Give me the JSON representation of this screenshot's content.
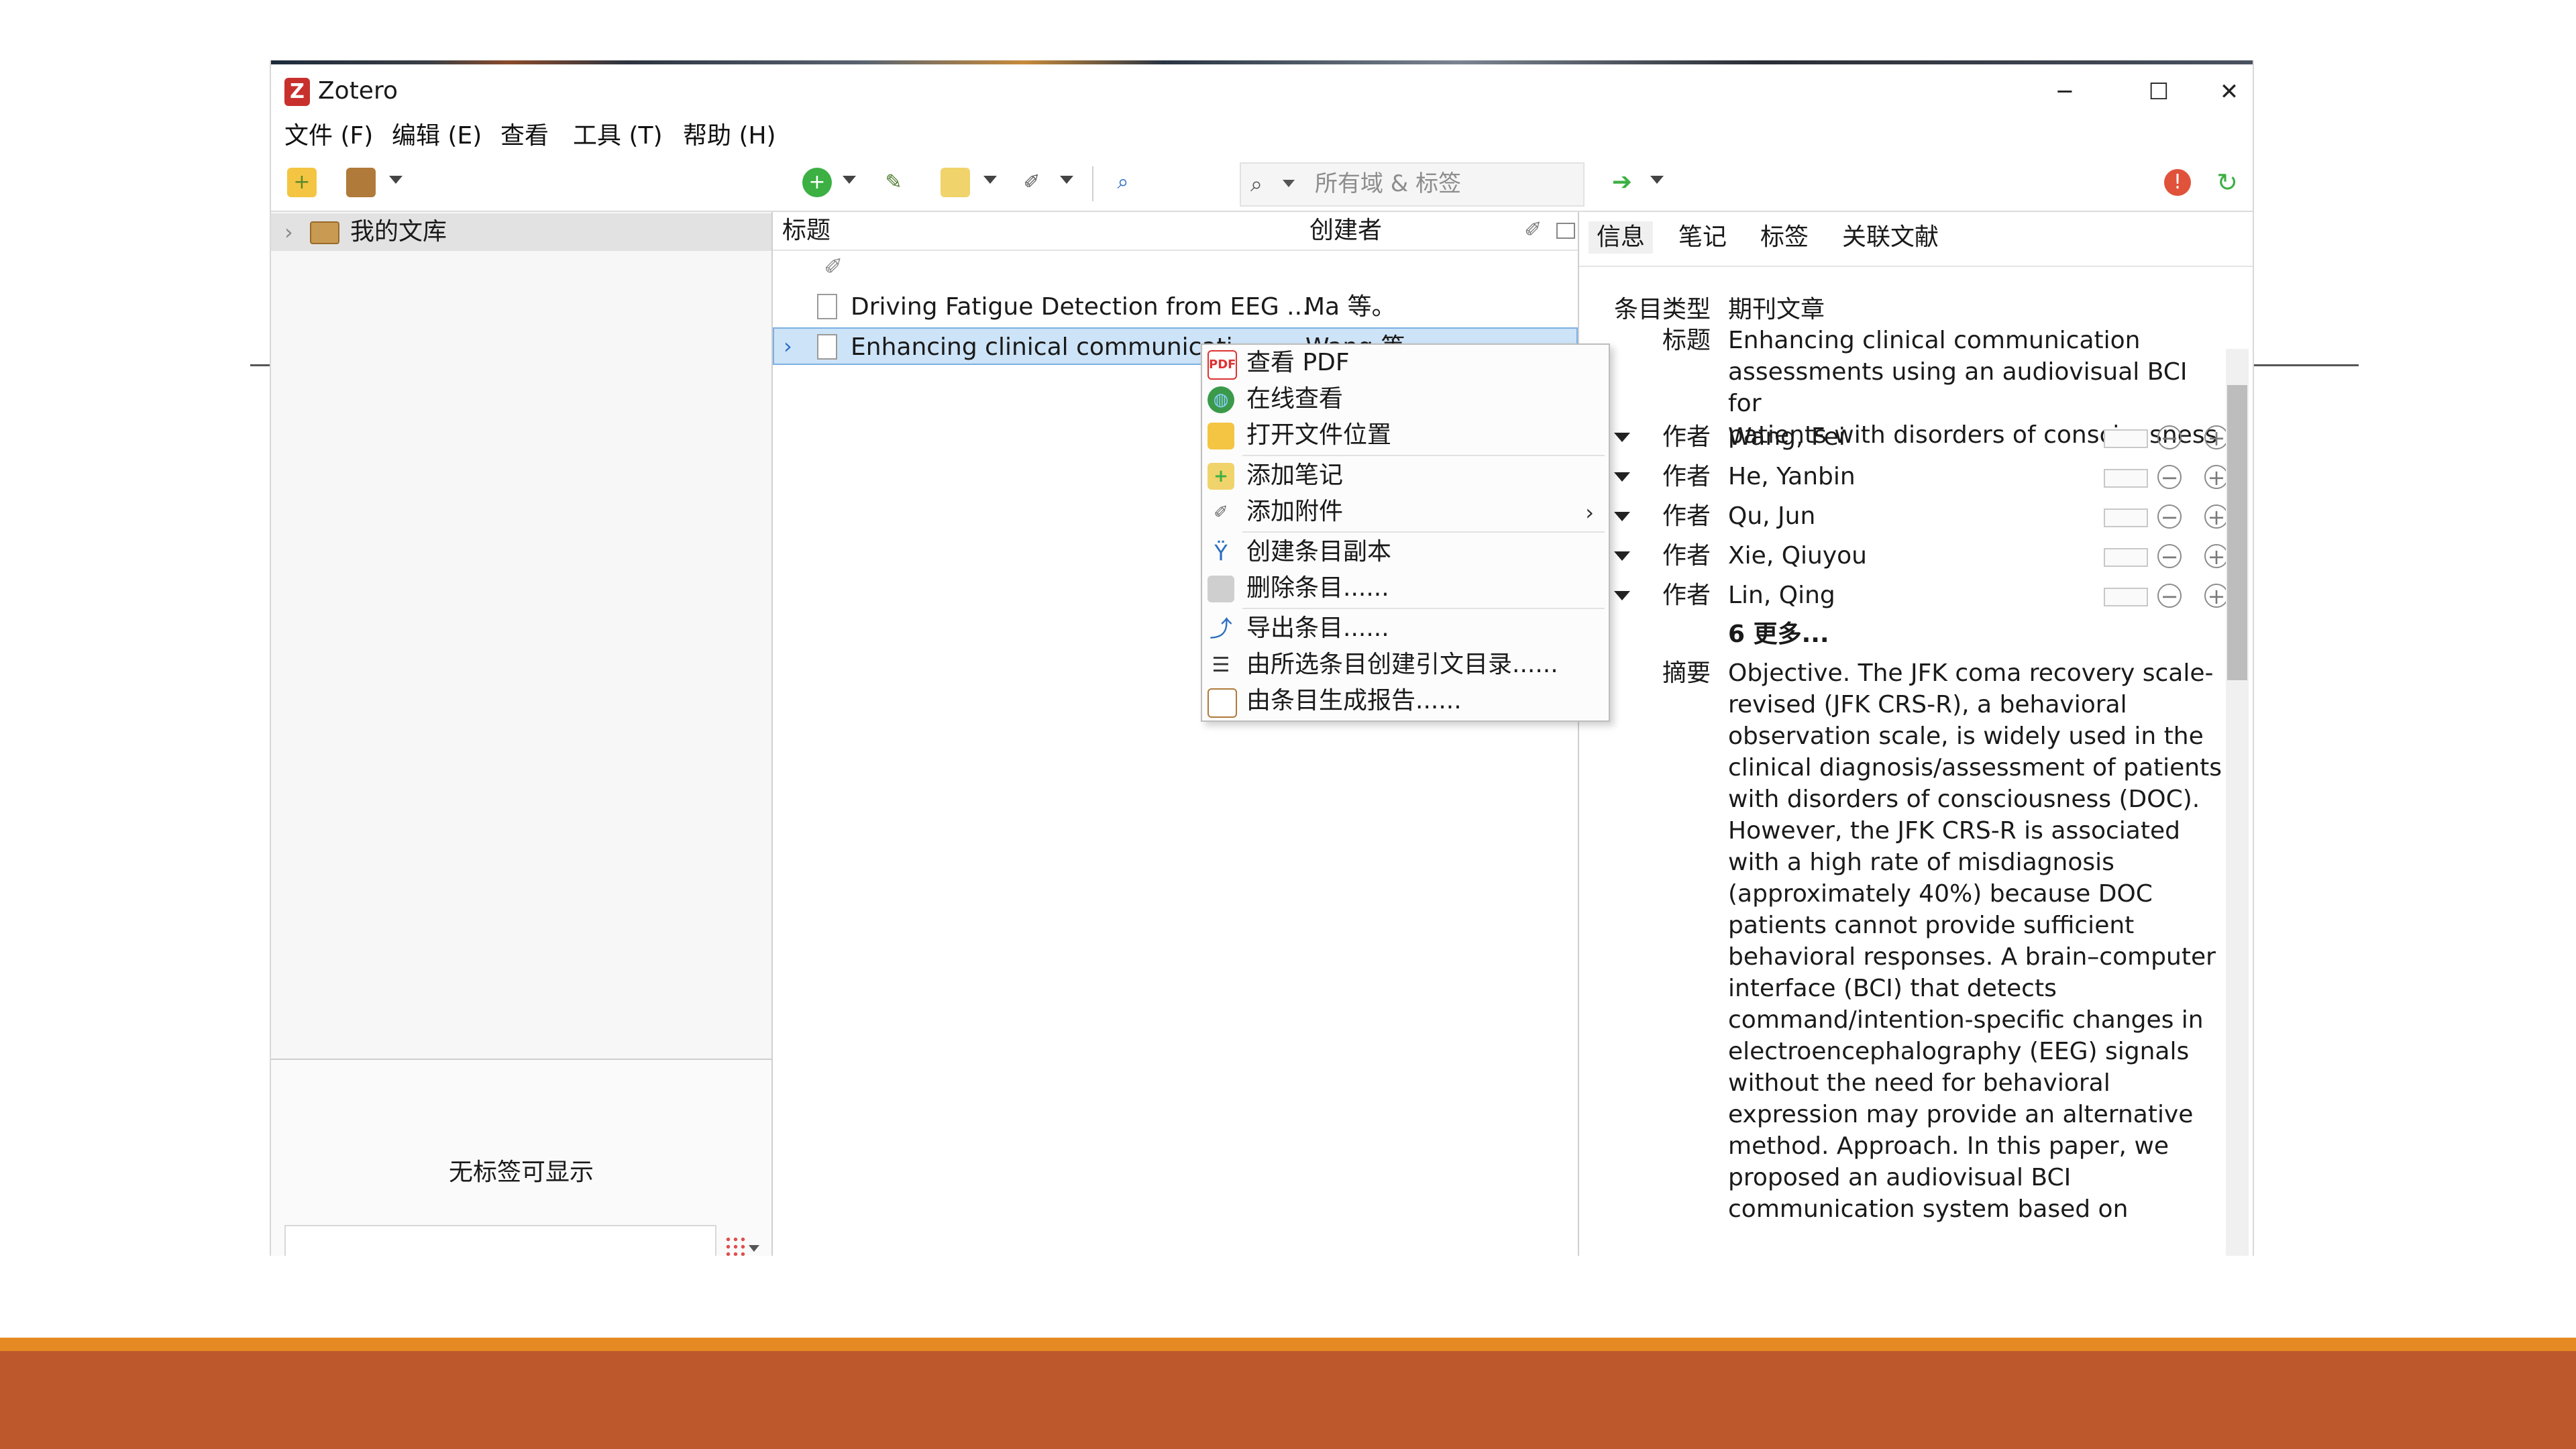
{
  "window": {
    "app_title": "Zotero",
    "minimize_glyph": "─",
    "maximize_glyph": "☐",
    "close_glyph": "✕"
  },
  "menu": [
    "文件 (F)",
    "编辑 (E)",
    "查看",
    "工具 (T)",
    "帮助 (H)"
  ],
  "toolbar": {
    "search_placeholder": "所有域 & 标签",
    "icons": [
      "new-collection-icon",
      "new-library-icon",
      "new-item-icon",
      "add-by-identifier-icon",
      "new-note-icon",
      "add-attachment-icon",
      "advanced-search-icon",
      "locate-icon",
      "error-icon",
      "sync-icon"
    ]
  },
  "left_pane": {
    "library_label": "我的文库",
    "no_tags": "无标签可显示"
  },
  "items": {
    "columns": {
      "title": "标题",
      "creator": "创建者"
    },
    "rows": [
      {
        "title": "Driving Fatigue Detection from EEG ...",
        "creator": "Ma 等。"
      },
      {
        "title": "Enhancing clinical communicati",
        "creator": "Wang 等"
      }
    ]
  },
  "context_menu": [
    {
      "label": "查看 PDF",
      "icon": "pdf-icon"
    },
    {
      "label": "在线查看",
      "icon": "globe-icon"
    },
    {
      "label": "打开文件位置",
      "icon": "folder-icon"
    },
    {
      "label": "添加笔记",
      "icon": "note-icon"
    },
    {
      "label": "添加附件",
      "icon": "paperclip-icon"
    },
    {
      "label": "创建条目副本",
      "icon": "duplicate-icon"
    },
    {
      "label": "删除条目......",
      "icon": "trash-icon"
    },
    {
      "label": "导出条目......",
      "icon": "export-icon"
    },
    {
      "label": "由所选条目创建引文目录......",
      "icon": "bibliography-icon"
    },
    {
      "label": "由条目生成报告......",
      "icon": "report-icon"
    }
  ],
  "info": {
    "tabs": [
      "信息",
      "笔记",
      "标签",
      "关联文献"
    ],
    "item_type_label": "条目类型",
    "item_type": "期刊文章",
    "title_label": "标题",
    "title_lines": [
      "Enhancing clinical communication",
      "assessments using an audiovisual BCI for",
      "patients with disorders of consciousness"
    ],
    "author_label": "作者",
    "authors": [
      "Wang, Fei",
      "He, Yanbin",
      "Qu, Jun",
      "Xie, Qiuyou",
      "Lin, Qing"
    ],
    "more": "6 更多...",
    "abstract_label": "摘要",
    "abstract_lines": [
      "Objective. The JFK coma recovery scale-",
      "revised (JFK CRS-R), a behavioral",
      "observation scale, is widely used in the",
      "clinical diagnosis/assessment of patients",
      "with disorders of consciousness (DOC).",
      "However, the JFK CRS-R is associated",
      "with a high rate of misdiagnosis",
      "(approximately 40%) because DOC",
      "patients cannot provide sufficient",
      "behavioral responses. A brain–computer",
      "interface (BCI) that detects",
      "command/intention-specific changes in",
      "electroencephalography (EEG) signals",
      "without the need for behavioral",
      "expression may provide an alternative",
      "method. Approach. In this paper, we",
      "proposed an audiovisual BCI",
      "communication system based on"
    ]
  }
}
